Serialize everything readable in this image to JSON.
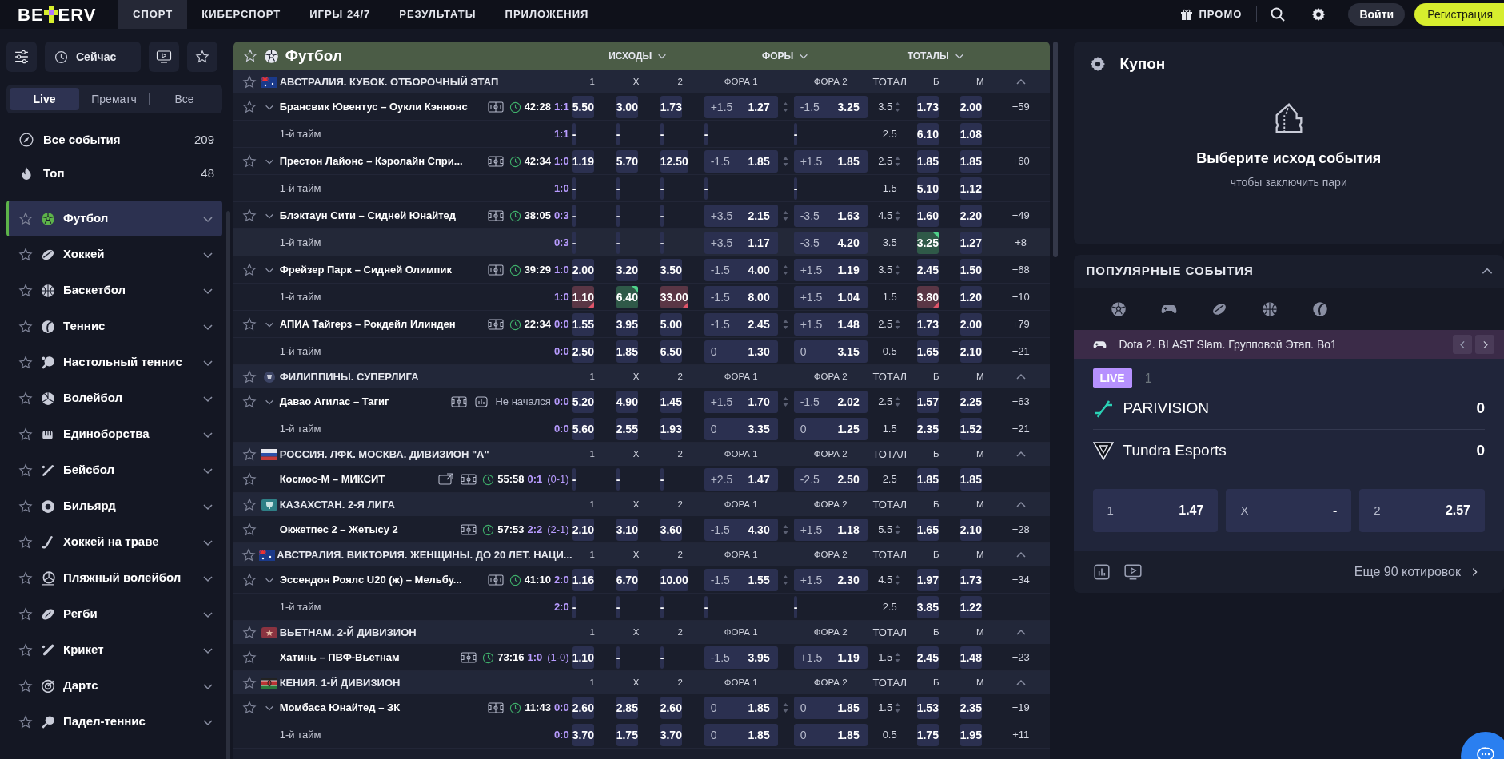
{
  "header": {
    "logo": {
      "left": "BE",
      "right": "ERV"
    },
    "nav": [
      {
        "label": "СПОРТ",
        "selected": true
      },
      {
        "label": "КИБЕРСПОРТ",
        "selected": false
      },
      {
        "label": "ИГРЫ 24/7",
        "selected": false
      },
      {
        "label": "РЕЗУЛЬТАТЫ",
        "selected": false
      },
      {
        "label": "ПРИЛОЖЕНИЯ",
        "selected": false
      }
    ],
    "promo": "ПРОМО",
    "login": "Войти",
    "register": "Регистрация"
  },
  "sidebar": {
    "now_button": "Сейчас",
    "tabs": [
      {
        "label": "Live",
        "selected": true
      },
      {
        "label": "Прематч",
        "selected": false
      },
      {
        "label": "Все",
        "selected": false
      }
    ],
    "quick": [
      {
        "kind": "all",
        "label": "Все события",
        "count": "209"
      },
      {
        "kind": "top",
        "label": "Топ",
        "count": "48"
      }
    ],
    "sports": [
      {
        "kind": "football",
        "label": "Футбол",
        "selected": true
      },
      {
        "kind": "hockey",
        "label": "Хоккей",
        "selected": false
      },
      {
        "kind": "basketball",
        "label": "Баскетбол",
        "selected": false
      },
      {
        "kind": "tennis",
        "label": "Теннис",
        "selected": false
      },
      {
        "kind": "tabletennis",
        "label": "Настольный теннис",
        "selected": false
      },
      {
        "kind": "volleyball",
        "label": "Волейбол",
        "selected": false
      },
      {
        "kind": "martial",
        "label": "Единоборства",
        "selected": false
      },
      {
        "kind": "baseball",
        "label": "Бейсбол",
        "selected": false
      },
      {
        "kind": "billiards",
        "label": "Бильярд",
        "selected": false
      },
      {
        "kind": "fieldhockey",
        "label": "Хоккей на траве",
        "selected": false
      },
      {
        "kind": "beachvolley",
        "label": "Пляжный волейбол",
        "selected": false
      },
      {
        "kind": "rugby",
        "label": "Регби",
        "selected": false
      },
      {
        "kind": "cricket",
        "label": "Крикет",
        "selected": false
      },
      {
        "kind": "darts",
        "label": "Дартс",
        "selected": false
      },
      {
        "kind": "padel",
        "label": "Падел-теннис",
        "selected": false
      }
    ]
  },
  "events": {
    "kind": "football",
    "title": "Футбол",
    "markets": [
      "ИСХОДЫ",
      "ФОРЫ",
      "ТОТАЛЫ"
    ],
    "leagues": [
      {
        "emblem": {
          "kind": "australia"
        },
        "name": "АВСТРАЛИЯ. КУБОК. ОТБОРОЧНЫЙ ЭТАП",
        "columns": [
          "1",
          "X",
          "2",
          "ФОРА 1",
          "ФОРА 2",
          "ТОТАЛ",
          "Б",
          "М"
        ],
        "rows": [
          {
            "kind": "match",
            "name": "Брансвик Ювентус – Оукли Кэннонс",
            "icons": [
              {
                "kind": "field"
              }
            ],
            "time": "42:28",
            "score": "1:1",
            "odds": [
              "5.50",
              "3.00",
              "1.73"
            ],
            "fora1": [
              "+1.5",
              "1.27"
            ],
            "fora2": [
              "-1.5",
              "3.25"
            ],
            "total": "3.5",
            "b": "1.73",
            "m": "2.00",
            "more": "+59",
            "fora_alt": true,
            "total_alt": true
          },
          {
            "kind": "period",
            "name": "1-й тайм",
            "score": "1:1",
            "odds": [
              "-",
              "-",
              "-"
            ],
            "fora1": [
              "-"
            ],
            "fora2": [
              "-"
            ],
            "total": "2.5",
            "b": "6.10",
            "m": "1.08"
          },
          {
            "kind": "match",
            "name": "Престон Лайонс – Кэролайн Спри...",
            "icons": [
              {
                "kind": "field"
              }
            ],
            "time": "42:34",
            "score": "1:0",
            "odds": [
              "1.19",
              "5.70",
              "12.50"
            ],
            "fora1": [
              "-1.5",
              "1.85"
            ],
            "fora2": [
              "+1.5",
              "1.85"
            ],
            "total": "2.5",
            "b": "1.85",
            "m": "1.85",
            "more": "+60",
            "fora_alt": true,
            "total_alt": true
          },
          {
            "kind": "period",
            "name": "1-й тайм",
            "score": "1:0",
            "odds": [
              "-",
              "-",
              "-"
            ],
            "fora1": [
              "-"
            ],
            "fora2": [
              "-"
            ],
            "total": "1.5",
            "b": "5.10",
            "m": "1.12"
          },
          {
            "kind": "match",
            "name": "Блэктаун Сити – Сидней Юнайтед",
            "icons": [
              {
                "kind": "field"
              }
            ],
            "time": "38:05",
            "score": "0:3",
            "odds": [
              "-",
              "-",
              "-"
            ],
            "fora1": [
              "+3.5",
              "2.15"
            ],
            "fora2": [
              "-3.5",
              "1.63"
            ],
            "total": "4.5",
            "b": "1.60",
            "m": "2.20",
            "more": "+49",
            "fora_alt": true,
            "total_alt": true
          },
          {
            "kind": "period",
            "name": "1-й тайм",
            "score": "0:3",
            "highlighted": true,
            "odds": [
              "-",
              "-",
              "-"
            ],
            "fora1": [
              "+3.5",
              "1.17"
            ],
            "fora2": [
              "-3.5",
              "4.20"
            ],
            "total": "3.5",
            "b": {
              "v": "3.25",
              "kind": "up"
            },
            "m": "1.27",
            "more": "+8"
          },
          {
            "kind": "match",
            "name": "Фрейзер Парк – Сидней Олимпик",
            "icons": [
              {
                "kind": "field"
              }
            ],
            "time": "39:29",
            "score": "1:0",
            "odds": [
              "2.00",
              "3.20",
              "3.50"
            ],
            "fora1": [
              "-1.5",
              "4.00"
            ],
            "fora2": [
              "+1.5",
              "1.19"
            ],
            "total": "3.5",
            "b": "2.45",
            "m": "1.50",
            "more": "+68",
            "fora_alt": true,
            "total_alt": true
          },
          {
            "kind": "period",
            "name": "1-й тайм",
            "score": "1:0",
            "odds": [
              {
                "v": "1.10",
                "kind": "down"
              },
              {
                "v": "6.40",
                "kind": "up"
              },
              {
                "v": "33.00",
                "kind": "down"
              }
            ],
            "fora1": [
              "-1.5",
              "8.00"
            ],
            "fora2": [
              "+1.5",
              "1.04"
            ],
            "total": "1.5",
            "b": {
              "v": "3.80",
              "kind": "down"
            },
            "m": "1.20",
            "more": "+10"
          },
          {
            "kind": "match",
            "name": "АПИА Тайгерз – Рокдейл Илинден",
            "icons": [
              {
                "kind": "field"
              }
            ],
            "time": "22:34",
            "score": "0:0",
            "odds": [
              "1.55",
              "3.95",
              "5.00"
            ],
            "fora1": [
              "-1.5",
              "2.45"
            ],
            "fora2": [
              "+1.5",
              "1.48"
            ],
            "total": "2.5",
            "b": "1.73",
            "m": "2.00",
            "more": "+79",
            "fora_alt": true,
            "total_alt": true
          },
          {
            "kind": "period",
            "name": "1-й тайм",
            "score": "0:0",
            "odds": [
              "2.50",
              "1.85",
              "6.50"
            ],
            "fora1": [
              "0",
              "1.30"
            ],
            "fora2": [
              "0",
              "3.15"
            ],
            "total": "0.5",
            "b": "1.65",
            "m": "2.10",
            "more": "+21"
          }
        ]
      },
      {
        "emblem": {
          "kind": "badge"
        },
        "name": "ФИЛИППИНЫ. СУПЕРЛИГА",
        "columns": [
          "1",
          "X",
          "2",
          "ФОРА 1",
          "ФОРА 2",
          "ТОТАЛ",
          "Б",
          "М"
        ],
        "rows": [
          {
            "kind": "match",
            "name": "Давао Агилас – Тагиг",
            "icons": [
              {
                "kind": "field"
              },
              {
                "kind": "stats"
              }
            ],
            "status": "Не начался",
            "score": "0:0",
            "odds": [
              "5.20",
              "4.90",
              "1.45"
            ],
            "fora1": [
              "+1.5",
              "1.70"
            ],
            "fora2": [
              "-1.5",
              "2.02"
            ],
            "total": "2.5",
            "b": "1.57",
            "m": "2.25",
            "more": "+63",
            "fora_alt": true,
            "total_alt": true
          },
          {
            "kind": "period",
            "name": "1-й тайм",
            "score": "0:0",
            "odds": [
              "5.60",
              "2.55",
              "1.93"
            ],
            "fora1": [
              "0",
              "3.35"
            ],
            "fora2": [
              "0",
              "1.25"
            ],
            "total": "1.5",
            "b": "2.35",
            "m": "1.52",
            "more": "+21"
          }
        ]
      },
      {
        "emblem": {
          "kind": "russia"
        },
        "name": "РОССИЯ. ЛФК. МОСКВА. ДИВИЗИОН \"А\"",
        "columns": [
          "1",
          "X",
          "2",
          "ФОРА 1",
          "ФОРА 2",
          "ТОТАЛ",
          "Б",
          "М"
        ],
        "rows": [
          {
            "kind": "match",
            "name": "Космос-М – МИКСИТ",
            "icons": [
              {
                "kind": "stream"
              },
              {
                "kind": "field"
              }
            ],
            "time": "55:58",
            "score": "0:1",
            "score_half": "(0-1)",
            "odds": [
              "-",
              "-",
              "-"
            ],
            "fora1": [
              "+2.5",
              "1.47"
            ],
            "fora2": [
              "-2.5",
              "2.50"
            ],
            "total": "2.5",
            "b": "1.85",
            "m": "1.85"
          }
        ]
      },
      {
        "emblem": {
          "kind": "kazakhstan"
        },
        "name": "КАЗАХСТАН. 2-Я ЛИГА",
        "columns": [
          "1",
          "X",
          "2",
          "ФОРА 1",
          "ФОРА 2",
          "ТОТАЛ",
          "Б",
          "М"
        ],
        "rows": [
          {
            "kind": "match",
            "name": "Окжетпес 2 – Жетысу 2",
            "icons": [
              {
                "kind": "field"
              }
            ],
            "time": "57:53",
            "score": "2:2",
            "score_half": "(2-1)",
            "odds": [
              "2.10",
              "3.10",
              "3.60"
            ],
            "fora1": [
              "-1.5",
              "4.30"
            ],
            "fora2": [
              "+1.5",
              "1.18"
            ],
            "total": "5.5",
            "b": "1.65",
            "m": "2.10",
            "more": "+28",
            "fora_alt": true,
            "total_alt": true
          }
        ]
      },
      {
        "emblem": {
          "kind": "australia"
        },
        "name": "АВСТРАЛИЯ. ВИКТОРИЯ. ЖЕНЩИНЫ. ДО 20 ЛЕТ. НАЦИ...",
        "columns": [
          "1",
          "X",
          "2",
          "ФОРА 1",
          "ФОРА 2",
          "ТОТАЛ",
          "Б",
          "М"
        ],
        "rows": [
          {
            "kind": "match",
            "name": "Эссендон Роялс U20 (ж) – Мельбу...",
            "icons": [
              {
                "kind": "field"
              }
            ],
            "time": "41:10",
            "score": "2:0",
            "odds": [
              "1.16",
              "6.70",
              "10.00"
            ],
            "fora1": [
              "-1.5",
              "1.55"
            ],
            "fora2": [
              "+1.5",
              "2.30"
            ],
            "total": "4.5",
            "b": "1.97",
            "m": "1.73",
            "more": "+34",
            "fora_alt": true,
            "total_alt": true
          },
          {
            "kind": "period",
            "name": "1-й тайм",
            "score": "2:0",
            "odds": [
              "-",
              "-",
              "-"
            ],
            "fora1": [
              "-"
            ],
            "fora2": [
              "-"
            ],
            "total": "2.5",
            "b": "3.85",
            "m": "1.22"
          }
        ]
      },
      {
        "emblem": {
          "kind": "vietnam"
        },
        "name": "ВЬЕТНАМ. 2-Й ДИВИЗИОН",
        "columns": [
          "1",
          "X",
          "2",
          "ФОРА 1",
          "ФОРА 2",
          "ТОТАЛ",
          "Б",
          "М"
        ],
        "rows": [
          {
            "kind": "match",
            "name": "Хатинь – ПВФ-Вьетнам",
            "icons": [
              {
                "kind": "field"
              }
            ],
            "time": "73:16",
            "score": "1:0",
            "score_half": "(1-0)",
            "odds": [
              "1.10",
              "-",
              "-"
            ],
            "fora1": [
              "-1.5",
              "3.95"
            ],
            "fora2": [
              "+1.5",
              "1.19"
            ],
            "total": "1.5",
            "b": "2.45",
            "m": "1.48",
            "more": "+23",
            "total_alt": true
          }
        ]
      },
      {
        "emblem": {
          "kind": "kenya"
        },
        "name": "КЕНИЯ. 1-Й ДИВИЗИОН",
        "columns": [
          "1",
          "X",
          "2",
          "ФОРА 1",
          "ФОРА 2",
          "ТОТАЛ",
          "Б",
          "М"
        ],
        "rows": [
          {
            "kind": "match",
            "name": "Момбаса Юнайтед – ЗК",
            "icons": [
              {
                "kind": "field"
              }
            ],
            "time": "11:43",
            "score": "0:0",
            "odds": [
              "2.60",
              "2.85",
              "2.60"
            ],
            "fora1": [
              "0",
              "1.85"
            ],
            "fora2": [
              "0",
              "1.85"
            ],
            "total": "1.5",
            "b": "1.53",
            "m": "2.35",
            "more": "+19",
            "fora_alt": true,
            "total_alt": true
          },
          {
            "kind": "period",
            "name": "1-й тайм",
            "score": "0:0",
            "odds": [
              "3.70",
              "1.75",
              "3.70"
            ],
            "fora1": [
              "0",
              "1.85"
            ],
            "fora2": [
              "0",
              "1.85"
            ],
            "total": "0.5",
            "b": "1.75",
            "m": "1.95",
            "more": "+11"
          }
        ]
      }
    ]
  },
  "coupon": {
    "title": "Купон",
    "heading": "Выберите исход события",
    "hint": "чтобы заключить пари"
  },
  "popular": {
    "title": "ПОПУЛЯРНЫЕ СОБЫТИЯ",
    "sports": [
      {
        "kind": "football"
      },
      {
        "kind": "esports"
      },
      {
        "kind": "hockey"
      },
      {
        "kind": "basketball"
      },
      {
        "kind": "tennis"
      }
    ],
    "event": {
      "kind": "esports",
      "tournament": "Dota 2. BLAST Slam. Групповой Этап. Bo1",
      "status": "LIVE",
      "map": "1",
      "teams": [
        {
          "name": "PARIVISION",
          "kind": "parivision",
          "score": "0"
        },
        {
          "name": "Tundra Esports",
          "kind": "tundra",
          "score": "0"
        }
      ],
      "odds": [
        {
          "label": "1",
          "value": "1.47"
        },
        {
          "label": "X",
          "value": "-"
        },
        {
          "label": "2",
          "value": "2.57"
        }
      ],
      "more": "Еще 90 котировок"
    }
  }
}
